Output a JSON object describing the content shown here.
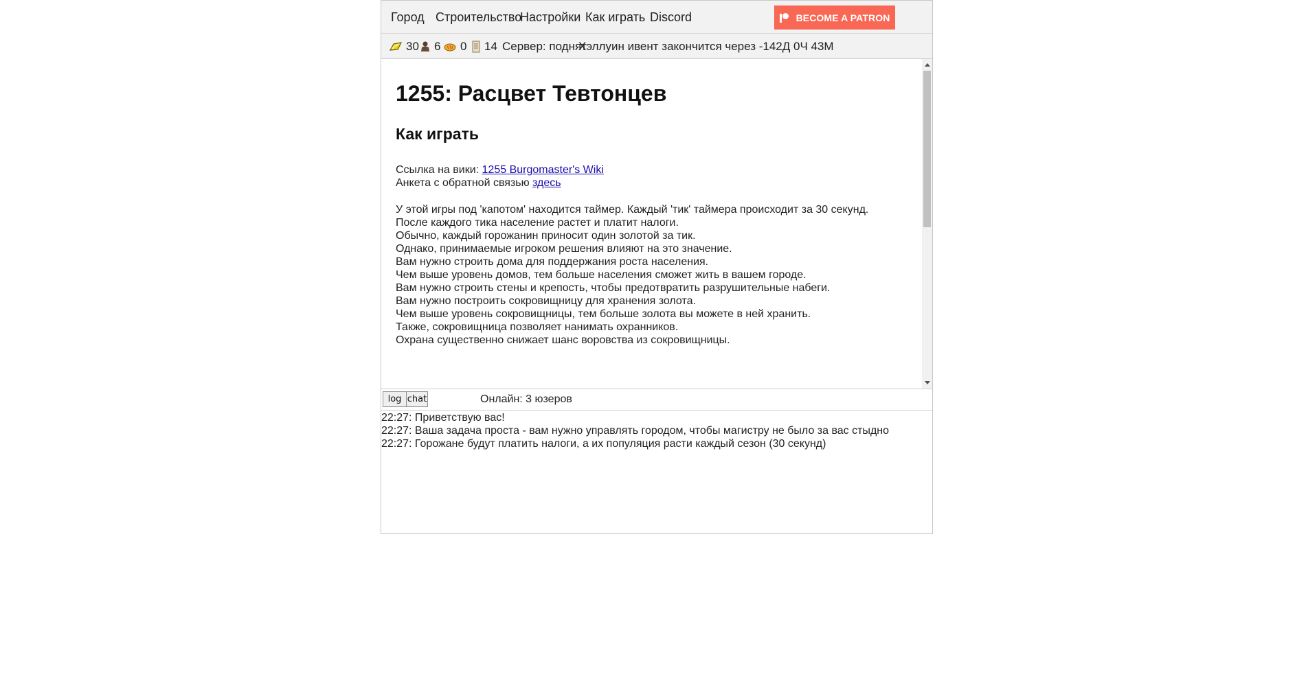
{
  "nav": {
    "items": [
      "Город",
      "Строительство",
      "Настройки",
      "Как играть",
      "Discord"
    ],
    "patron_label": "BECOME A PATRON"
  },
  "resources": {
    "gold": "30",
    "population": "6",
    "bread": "0",
    "scroll": "14",
    "server_status": "Сервер: поднят",
    "event": "Хэллуин ивент закончится через -142Д 0Ч 43М"
  },
  "content": {
    "title": "1255: Расцвет Тевтонцев",
    "subtitle": "Как играть",
    "wiki_prefix": "Ссылка на вики: ",
    "wiki_link": "1255 Burgomaster's Wiki",
    "survey_prefix": "Анкета с обратной связью ",
    "survey_link": "здесь",
    "paragraphs": [
      "У этой игры под 'капотом' находится таймер. Каждый 'тик' таймера происходит за 30 секунд.",
      "После каждого тика население растет и платит налоги.",
      "Обычно, каждый горожанин приносит один золотой за тик.",
      "Однако, принимаемые игроком решения влияют на это значение.",
      "Вам нужно строить дома для поддержания роста населения.",
      "Чем выше уровень домов, тем больше населения сможет жить в вашем городе.",
      "Вам нужно строить стены и крепость, чтобы предотвратить разрушительные набеги.",
      "Вам нужно построить сокровищницу для хранения золота.",
      "Чем выше уровень сокровищницы, тем больше золота вы можете в ней хранить.",
      "Также, сокровищница позволяет нанимать охранников.",
      "Охрана существенно снижает шанс воровства из сокровищницы."
    ]
  },
  "tabs": {
    "log_label": "log",
    "chat_label": "chat",
    "online": "Онлайн: 3 юзеров"
  },
  "log": [
    "22:27: Приветствую вас!",
    "22:27: Ваша задача проста - вам нужно управлять городом, чтобы магистру не было за вас стыдно",
    "22:27: Горожане будут платить налоги, а их популяция расти каждый сезон (30 секунд)"
  ],
  "colors": {
    "patron": "#f96854",
    "link": "#1a0dab",
    "bar_bg": "#f2f2f2"
  }
}
